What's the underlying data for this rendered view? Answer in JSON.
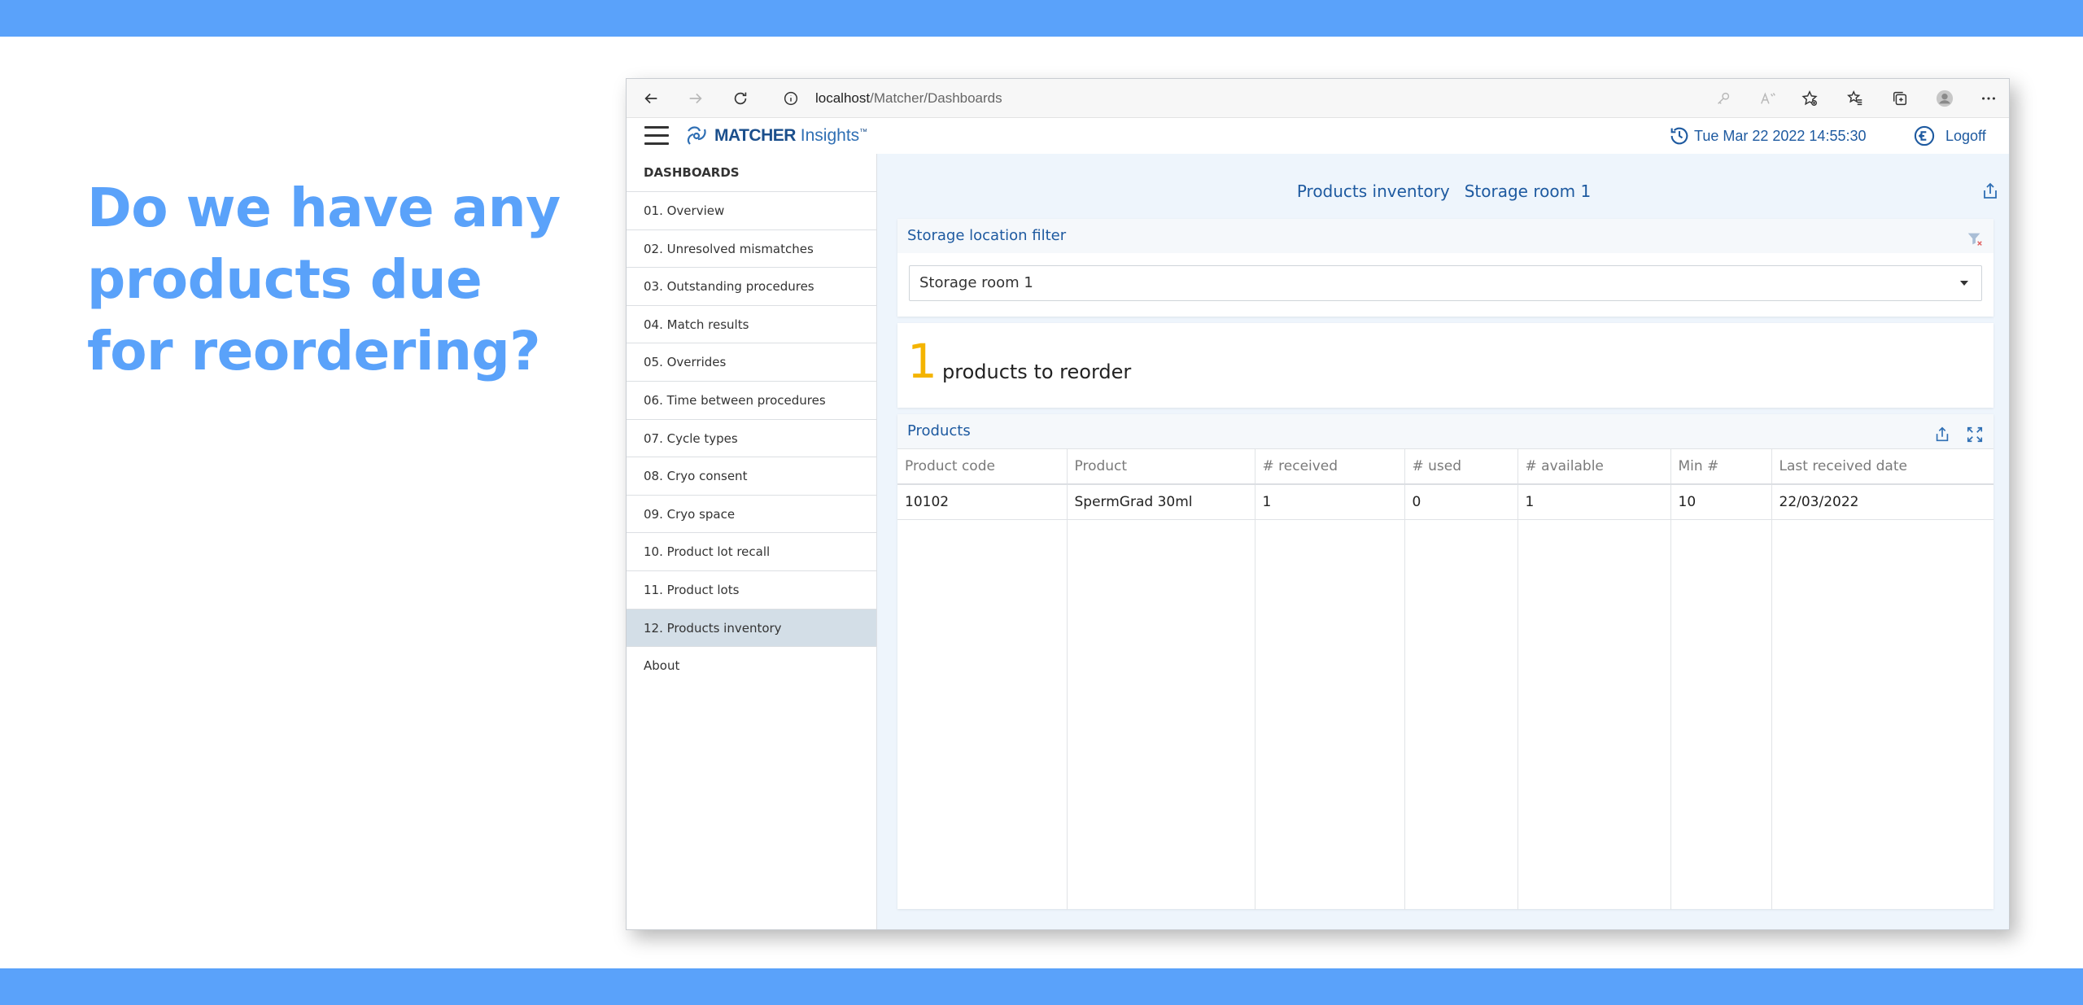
{
  "headline": "Do we have any products due for reordering?",
  "browser": {
    "url_host": "localhost",
    "url_path": "/Matcher/Dashboards"
  },
  "app": {
    "logo_brand": "MATCHER",
    "logo_product": "Insights",
    "logo_tm": "™",
    "datetime": "Tue Mar 22 2022 14:55:30",
    "logoff_label": "Logoff"
  },
  "sidebar": {
    "title": "DASHBOARDS",
    "items": [
      {
        "label": "01. Overview"
      },
      {
        "label": "02. Unresolved mismatches"
      },
      {
        "label": "03. Outstanding procedures"
      },
      {
        "label": "04. Match results"
      },
      {
        "label": "05. Overrides"
      },
      {
        "label": "06. Time between procedures"
      },
      {
        "label": "07. Cycle types"
      },
      {
        "label": "08. Cryo consent"
      },
      {
        "label": "09. Cryo space"
      },
      {
        "label": "10. Product lot recall"
      },
      {
        "label": "11. Product lots"
      },
      {
        "label": "12. Products inventory"
      },
      {
        "label": "About"
      }
    ],
    "active_index": 11
  },
  "main": {
    "title": "Products inventory",
    "subtitle": "Storage room 1",
    "filter": {
      "heading": "Storage location filter",
      "selected": "Storage room 1"
    },
    "kpi": {
      "value": "1",
      "label": "products to reorder",
      "color": "#f4b400"
    },
    "products": {
      "heading": "Products",
      "columns": [
        "Product code",
        "Product",
        "# received",
        "# used",
        "# available",
        "Min #",
        "Last received date"
      ],
      "rows": [
        [
          "10102",
          "SpermGrad 30ml",
          "1",
          "0",
          "1",
          "10",
          "22/03/2022"
        ]
      ]
    }
  },
  "colors": {
    "accent": "#5aa2fa",
    "app_blue": "#1e5aa0",
    "kpi_yellow": "#f4b400",
    "active_item": "#d3dee7"
  }
}
